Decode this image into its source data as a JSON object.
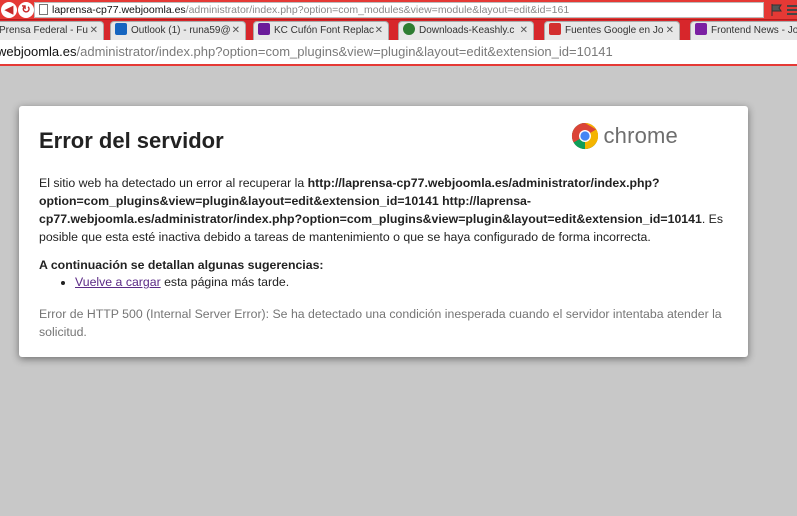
{
  "background_bar": {
    "url_host": "laprensa-cp77.webjoomla.es",
    "url_path": "/administrator/index.php?option=com_modules&view=module&layout=edit&id=161"
  },
  "tabs": [
    {
      "label": "Prensa Federal - Fu",
      "fav_color": "#2196f3"
    },
    {
      "label": "Outlook (1) - runa59@",
      "fav_color": "#1565c0"
    },
    {
      "label": "KC Cufón Font Replac",
      "fav_color": "#6a1b9a"
    },
    {
      "label": "Downloads-Keashly.c",
      "fav_color": "#2e7d32"
    },
    {
      "label": "Fuentes Google en Jo",
      "fav_color": "#d32f2f"
    },
    {
      "label": "Frontend News - Jo",
      "fav_color": "#7b1fa2"
    }
  ],
  "address_bar": {
    "host": "webjoomla.es",
    "path": "/administrator/index.php?option=com_plugins&view=plugin&layout=edit&extension_id=10141"
  },
  "error": {
    "title": "Error del servidor",
    "logo_text": "chrome",
    "intro": "El sitio web ha detectado un error al recuperar la ",
    "url1": "http://laprensa-cp77.webjoomla.es/administrator/index.php?option=com_plugins&view=plugin&layout=edit&extension_id=10141",
    "url2": "http://laprensa-cp77.webjoomla.es/administrator/index.php?option=com_plugins&view=plugin&layout=edit&extension_id=10141",
    "outro": ". Es posible que esta esté inactiva debido a tareas de mantenimiento o que se haya configurado de forma incorrecta.",
    "suggestions_title": "A continuación se detallan algunas sugerencias:",
    "reload_link": "Vuelve a cargar",
    "reload_rest": " esta página más tarde.",
    "http_message": "Error de HTTP 500 (Internal Server Error): Se ha detectado una condición inesperada cuando el servidor intentaba atender la solicitud."
  }
}
